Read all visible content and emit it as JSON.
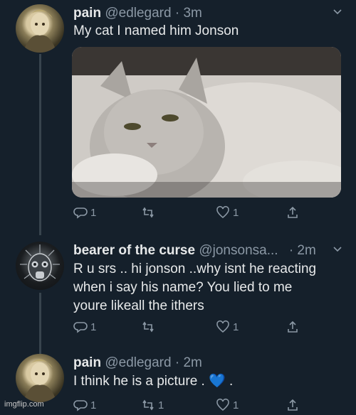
{
  "tweets": [
    {
      "name": "pain",
      "handle": "@edlegard",
      "time": "· 3m",
      "text": "My cat I named him Jonson",
      "reply_count": "1",
      "retweet_count": "",
      "like_count": "1"
    },
    {
      "name": "bearer of the curse",
      "handle": "@jonsonsa...",
      "time": "· 2m",
      "text_lines": [
        "R u srs .. hi jonson ..why isnt he reacting",
        "when i say his name? You lied to me",
        "youre likeall the ithers"
      ],
      "reply_count": "1",
      "retweet_count": "",
      "like_count": "1"
    },
    {
      "name": "pain",
      "handle": "@edlegard",
      "time": "· 2m",
      "text": "I think he is a picture . 💙 .",
      "reply_count": "1",
      "retweet_count": "1",
      "like_count": "1"
    }
  ],
  "watermark": "imgflip.com",
  "colors": {
    "background": "#15202b",
    "secondary_text": "#8b98a5",
    "thread_line": "#38444d"
  }
}
